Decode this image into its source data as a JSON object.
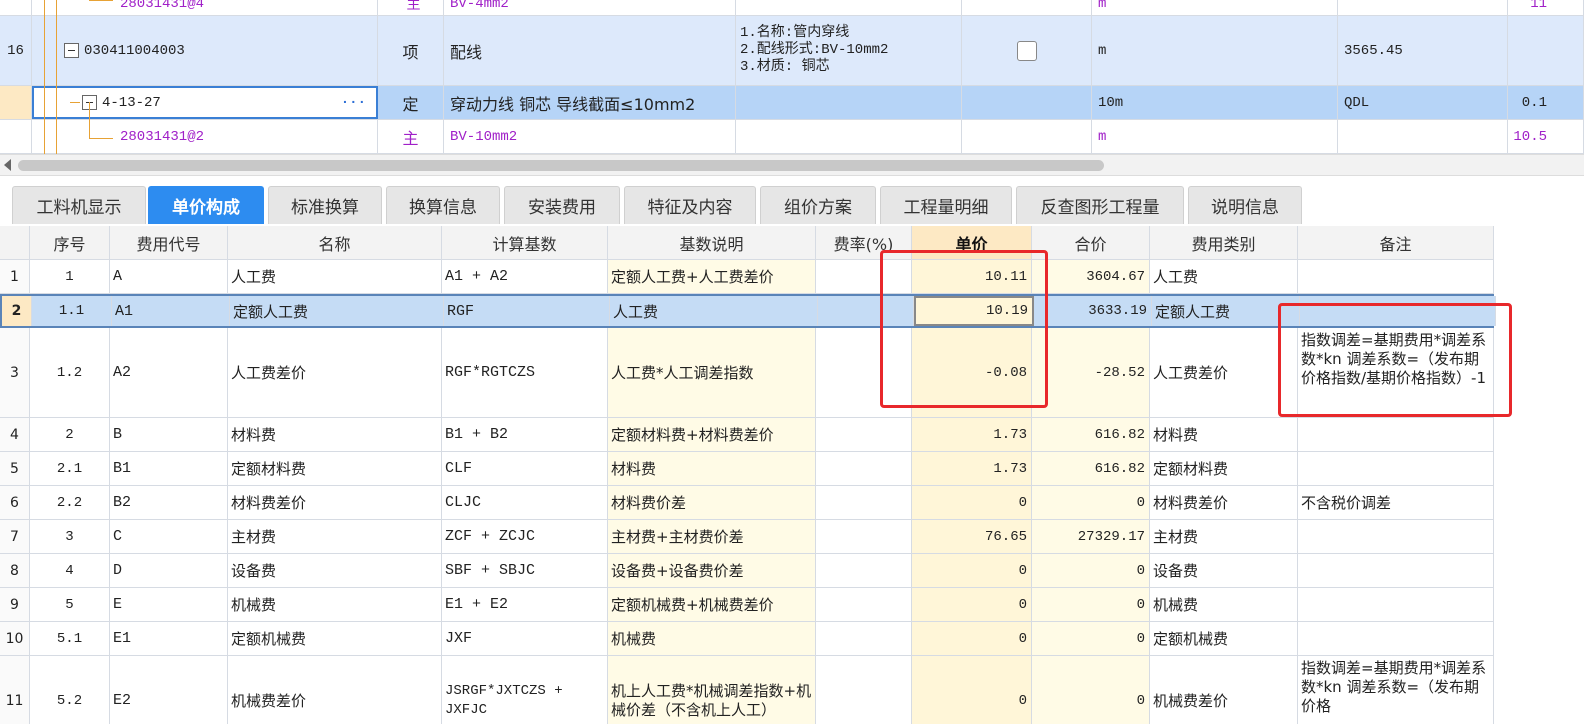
{
  "top_grid": {
    "rows": [
      {
        "num": "",
        "code": "28031431@4",
        "type": "主",
        "name": "BV-4mm2",
        "feature": "",
        "unit": "m",
        "qty": "",
        "amount": "11"
      },
      {
        "num": "16",
        "code": "030411004003",
        "type": "项",
        "name": "配线",
        "feature_lines": [
          "1.名称:管内穿线",
          "2.配线形式:BV-10mm2",
          "3.材质: 铜芯"
        ],
        "unit": "m",
        "qty": "3565.45",
        "amount": ""
      },
      {
        "num": "",
        "code": "4-13-27",
        "more": "···",
        "type": "定",
        "name": "穿动力线 铜芯 导线截面≤10mm2",
        "unit": "10m",
        "qty": "QDL",
        "amount": "0.1"
      },
      {
        "num": "",
        "code": "28031431@2",
        "type": "主",
        "name": "BV-10mm2",
        "unit": "m",
        "qty": "",
        "amount": "10.5"
      }
    ]
  },
  "tabs": [
    "工料机显示",
    "单价构成",
    "标准换算",
    "换算信息",
    "安装费用",
    "特征及内容",
    "组价方案",
    "工程量明细",
    "反查图形工程量",
    "说明信息"
  ],
  "active_tab": "单价构成",
  "table": {
    "headers": [
      "序号",
      "费用代号",
      "名称",
      "计算基数",
      "基数说明",
      "费率(%)",
      "单价",
      "合价",
      "费用类别",
      "备注"
    ],
    "rows": [
      {
        "n": "1",
        "seq": "1",
        "code": "A",
        "name": "人工费",
        "base": "A1 + A2",
        "desc": "定额人工费+人工费差价",
        "rate": "",
        "price": "10.11",
        "total": "3604.67",
        "cat": "人工费",
        "note": ""
      },
      {
        "n": "2",
        "seq": "1.1",
        "code": "A1",
        "name": "定额人工费",
        "base": "RGF",
        "desc": "人工费",
        "rate": "",
        "price": "10.19",
        "total": "3633.19",
        "cat": "定额人工费",
        "note": ""
      },
      {
        "n": "3",
        "seq": "1.2",
        "code": "A2",
        "name": "人工费差价",
        "base": "RGF*RGTCZS",
        "desc": "人工费*人工调差指数",
        "rate": "",
        "price": "-0.08",
        "total": "-28.52",
        "cat": "人工费差价",
        "note": "指数调差=基期费用*调差系数*kn 调差系数=（发布期价格指数/基期价格指数）-1"
      },
      {
        "n": "4",
        "seq": "2",
        "code": "B",
        "name": "材料费",
        "base": "B1 + B2",
        "desc": "定额材料费+材料费差价",
        "rate": "",
        "price": "1.73",
        "total": "616.82",
        "cat": "材料费",
        "note": ""
      },
      {
        "n": "5",
        "seq": "2.1",
        "code": "B1",
        "name": "定额材料费",
        "base": "CLF",
        "desc": "材料费",
        "rate": "",
        "price": "1.73",
        "total": "616.82",
        "cat": "定额材料费",
        "note": ""
      },
      {
        "n": "6",
        "seq": "2.2",
        "code": "B2",
        "name": "材料费差价",
        "base": "CLJC",
        "desc": "材料费价差",
        "rate": "",
        "price": "0",
        "total": "0",
        "cat": "材料费差价",
        "note": "不含税价调差"
      },
      {
        "n": "7",
        "seq": "3",
        "code": "C",
        "name": "主材费",
        "base": "ZCF + ZCJC",
        "desc": "主材费+主材费价差",
        "rate": "",
        "price": "76.65",
        "total": "27329.17",
        "cat": "主材费",
        "note": ""
      },
      {
        "n": "8",
        "seq": "4",
        "code": "D",
        "name": "设备费",
        "base": "SBF + SBJC",
        "desc": "设备费+设备费价差",
        "rate": "",
        "price": "0",
        "total": "0",
        "cat": "设备费",
        "note": ""
      },
      {
        "n": "9",
        "seq": "5",
        "code": "E",
        "name": "机械费",
        "base": "E1 + E2",
        "desc": "定额机械费+机械费差价",
        "rate": "",
        "price": "0",
        "total": "0",
        "cat": "机械费",
        "note": ""
      },
      {
        "n": "10",
        "seq": "5.1",
        "code": "E1",
        "name": "定额机械费",
        "base": "JXF",
        "desc": "机械费",
        "rate": "",
        "price": "0",
        "total": "0",
        "cat": "定额机械费",
        "note": ""
      },
      {
        "n": "11",
        "seq": "5.2",
        "code": "E2",
        "name": "机械费差价",
        "base": "JSRGF*JXTCZS + JXFJC",
        "desc": "机上人工费*机械调差指数+机械价差（不含机上人工）",
        "rate": "",
        "price": "0",
        "total": "0",
        "cat": "机械费差价",
        "note": "指数调差=基期费用*调差系数*kn 调差系数=（发布期价格"
      }
    ]
  },
  "colors": {
    "accent": "#2d8cf0",
    "selected_row": "#c5dcf5",
    "highlight_box": "#e8282b",
    "purple_text": "#a020c8"
  }
}
